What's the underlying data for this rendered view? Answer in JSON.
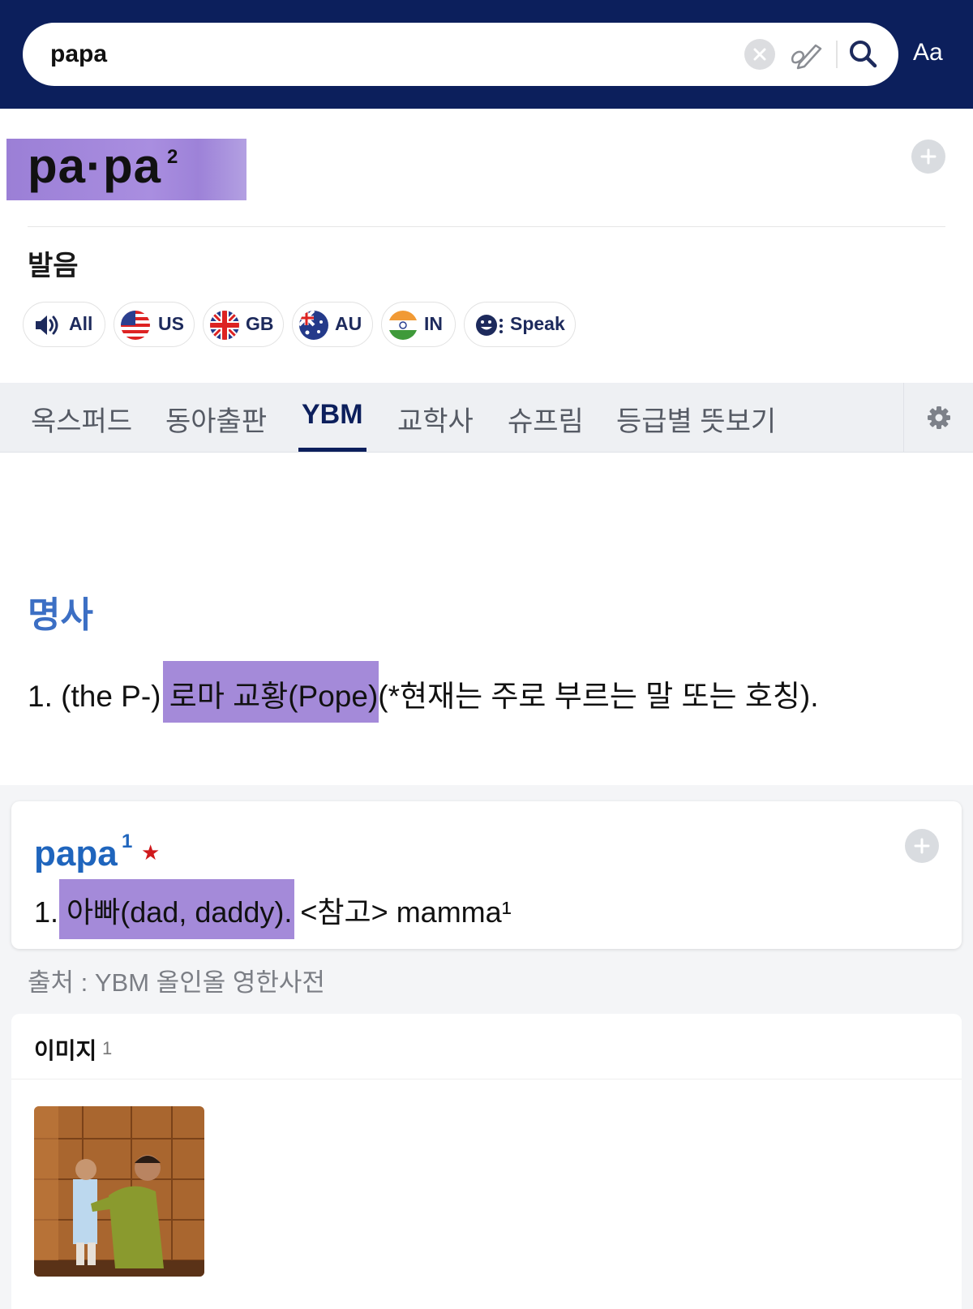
{
  "search": {
    "query": "papa",
    "font_button": "Aa"
  },
  "headword": {
    "word": "pa·pa",
    "homograph": "2"
  },
  "pronunciation": {
    "title": "발음",
    "buttons": [
      {
        "label": "All",
        "icon": "speaker-icon"
      },
      {
        "label": "US",
        "icon": "us-flag-icon"
      },
      {
        "label": "GB",
        "icon": "uk-flag-icon"
      },
      {
        "label": "AU",
        "icon": "au-flag-icon"
      },
      {
        "label": "IN",
        "icon": "in-flag-icon"
      },
      {
        "label": "Speak",
        "icon": "speak-face-icon"
      }
    ]
  },
  "tabs": [
    {
      "label": "옥스퍼드"
    },
    {
      "label": "동아출판"
    },
    {
      "label": "YBM",
      "active": true
    },
    {
      "label": "교학사"
    },
    {
      "label": "슈프림"
    },
    {
      "label": "등급별 뜻보기"
    }
  ],
  "entry": {
    "part_of_speech": "명사",
    "definition": "1. (the P-) 로마 교황(Pope)(*현재는 주로 부르는 말 또는 호칭)."
  },
  "related": {
    "word": "papa",
    "homograph": "1",
    "star": "★",
    "definition": "1. 아빠(dad, daddy). <참고> mamma¹"
  },
  "source": "출처 : YBM 올인올 영한사전",
  "images": {
    "title": "이미지",
    "count": "1"
  },
  "colors": {
    "header": "#0c1f5c",
    "highlight": "#a48ad9",
    "pos": "#3c6fc4",
    "related_word": "#1f65bd",
    "star": "#d0191c"
  }
}
